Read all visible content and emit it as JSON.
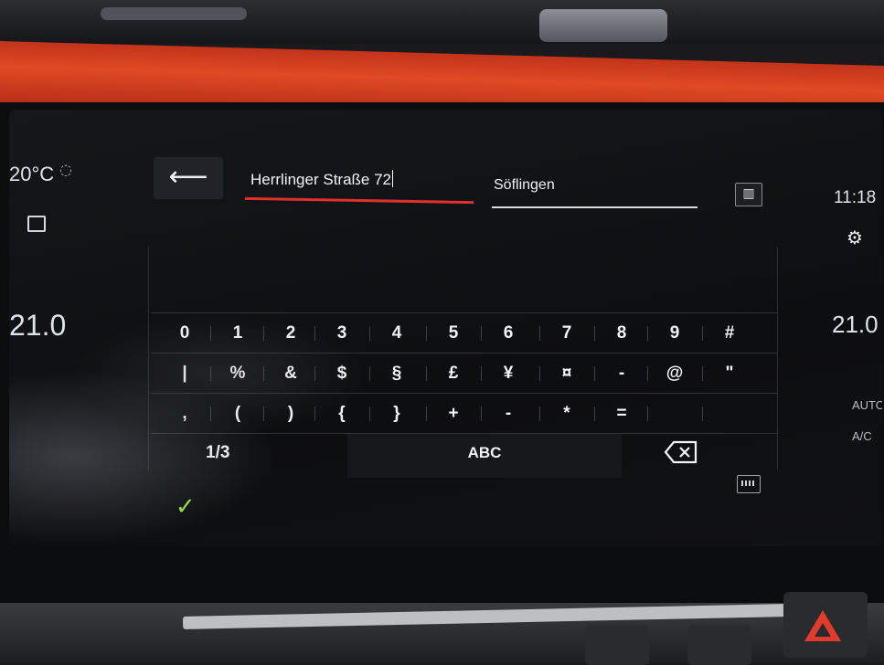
{
  "climate": {
    "outside_temp": "20°C",
    "driver_temp": "21.0",
    "passenger_temp": "21.0",
    "auto_label": "AUTO",
    "ac_label": "A/C"
  },
  "status": {
    "clock": "11:18"
  },
  "address": {
    "street_value": "Herrlinger Straße 72",
    "city_value": "Söflingen"
  },
  "keyboard": {
    "rows": [
      [
        "0",
        "1",
        "2",
        "3",
        "4",
        "5",
        "6",
        "7",
        "8",
        "9",
        "#"
      ],
      [
        "|",
        "%",
        "&",
        "$",
        "§",
        "£",
        "¥",
        "¤",
        "-",
        "@",
        "\""
      ],
      [
        ",",
        "(",
        ")",
        "{",
        "}",
        "+",
        "-",
        "*",
        "=",
        "",
        ""
      ]
    ],
    "page_label": "1/3",
    "abc_label": "ABC"
  },
  "colors": {
    "accent_red": "#e0322b",
    "confirm_green": "#9be03b",
    "trim_orange": "#e04a24"
  },
  "icons": {
    "back": "arrow-left-icon",
    "backspace": "backspace-icon",
    "confirm": "check-icon",
    "settings": "gear-icon",
    "location": "pin-icon",
    "city_map": "city-map-icon",
    "keyboard_hide": "keyboard-icon"
  }
}
